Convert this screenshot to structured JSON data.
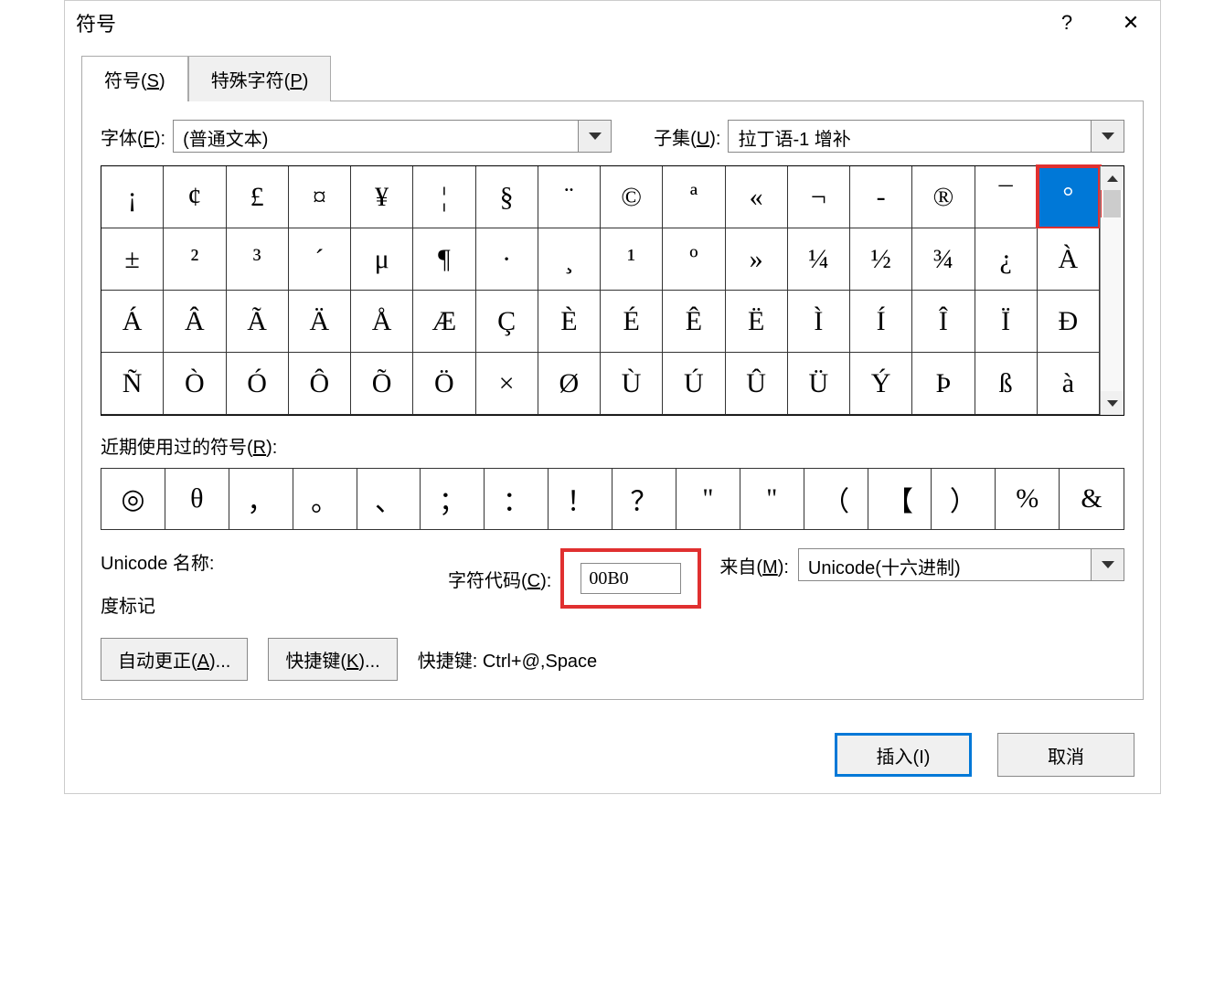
{
  "title": "符号",
  "help": "?",
  "close": "✕",
  "tabs": {
    "symbols": "符号(S)",
    "special": "特殊字符(P)"
  },
  "font": {
    "label": "字体(F):",
    "value": "(普通文本)"
  },
  "subset": {
    "label": "子集(U):",
    "value": "拉丁语-1 增补"
  },
  "grid": [
    "¡",
    "¢",
    "£",
    "¤",
    "¥",
    "¦",
    "§",
    "¨",
    "©",
    "ª",
    "«",
    "¬",
    "-",
    "®",
    "¯",
    "°",
    "±",
    "²",
    "³",
    "´",
    "μ",
    "¶",
    "·",
    "¸",
    "¹",
    "º",
    "»",
    "¼",
    "½",
    "¾",
    "¿",
    "À",
    "Á",
    "Â",
    "Ã",
    "Ä",
    "Å",
    "Æ",
    "Ç",
    "È",
    "É",
    "Ê",
    "Ë",
    "Ì",
    "Í",
    "Î",
    "Ï",
    "Đ",
    "Ñ",
    "Ò",
    "Ó",
    "Ô",
    "Õ",
    "Ö",
    "×",
    "Ø",
    "Ù",
    "Ú",
    "Û",
    "Ü",
    "Ý",
    "Þ",
    "ß",
    "à"
  ],
  "selected_index": 15,
  "recent_label": "近期使用过的符号(R):",
  "recent": [
    "◎",
    "θ",
    "，",
    "。",
    "、",
    "；",
    "：",
    "！",
    "？",
    "\"",
    "\"",
    "（",
    "【",
    "）",
    "%",
    "&"
  ],
  "unicode": {
    "title": "Unicode 名称:",
    "name": "度标记",
    "code_label": "字符代码(C):",
    "code": "00B0",
    "from_label": "来自(M):",
    "from_value": "Unicode(十六进制)"
  },
  "buttons": {
    "autocorrect": "自动更正(A)...",
    "shortcut_btn": "快捷键(K)...",
    "shortcut_text": "快捷键: Ctrl+@,Space",
    "insert": "插入(I)",
    "cancel": "取消"
  }
}
